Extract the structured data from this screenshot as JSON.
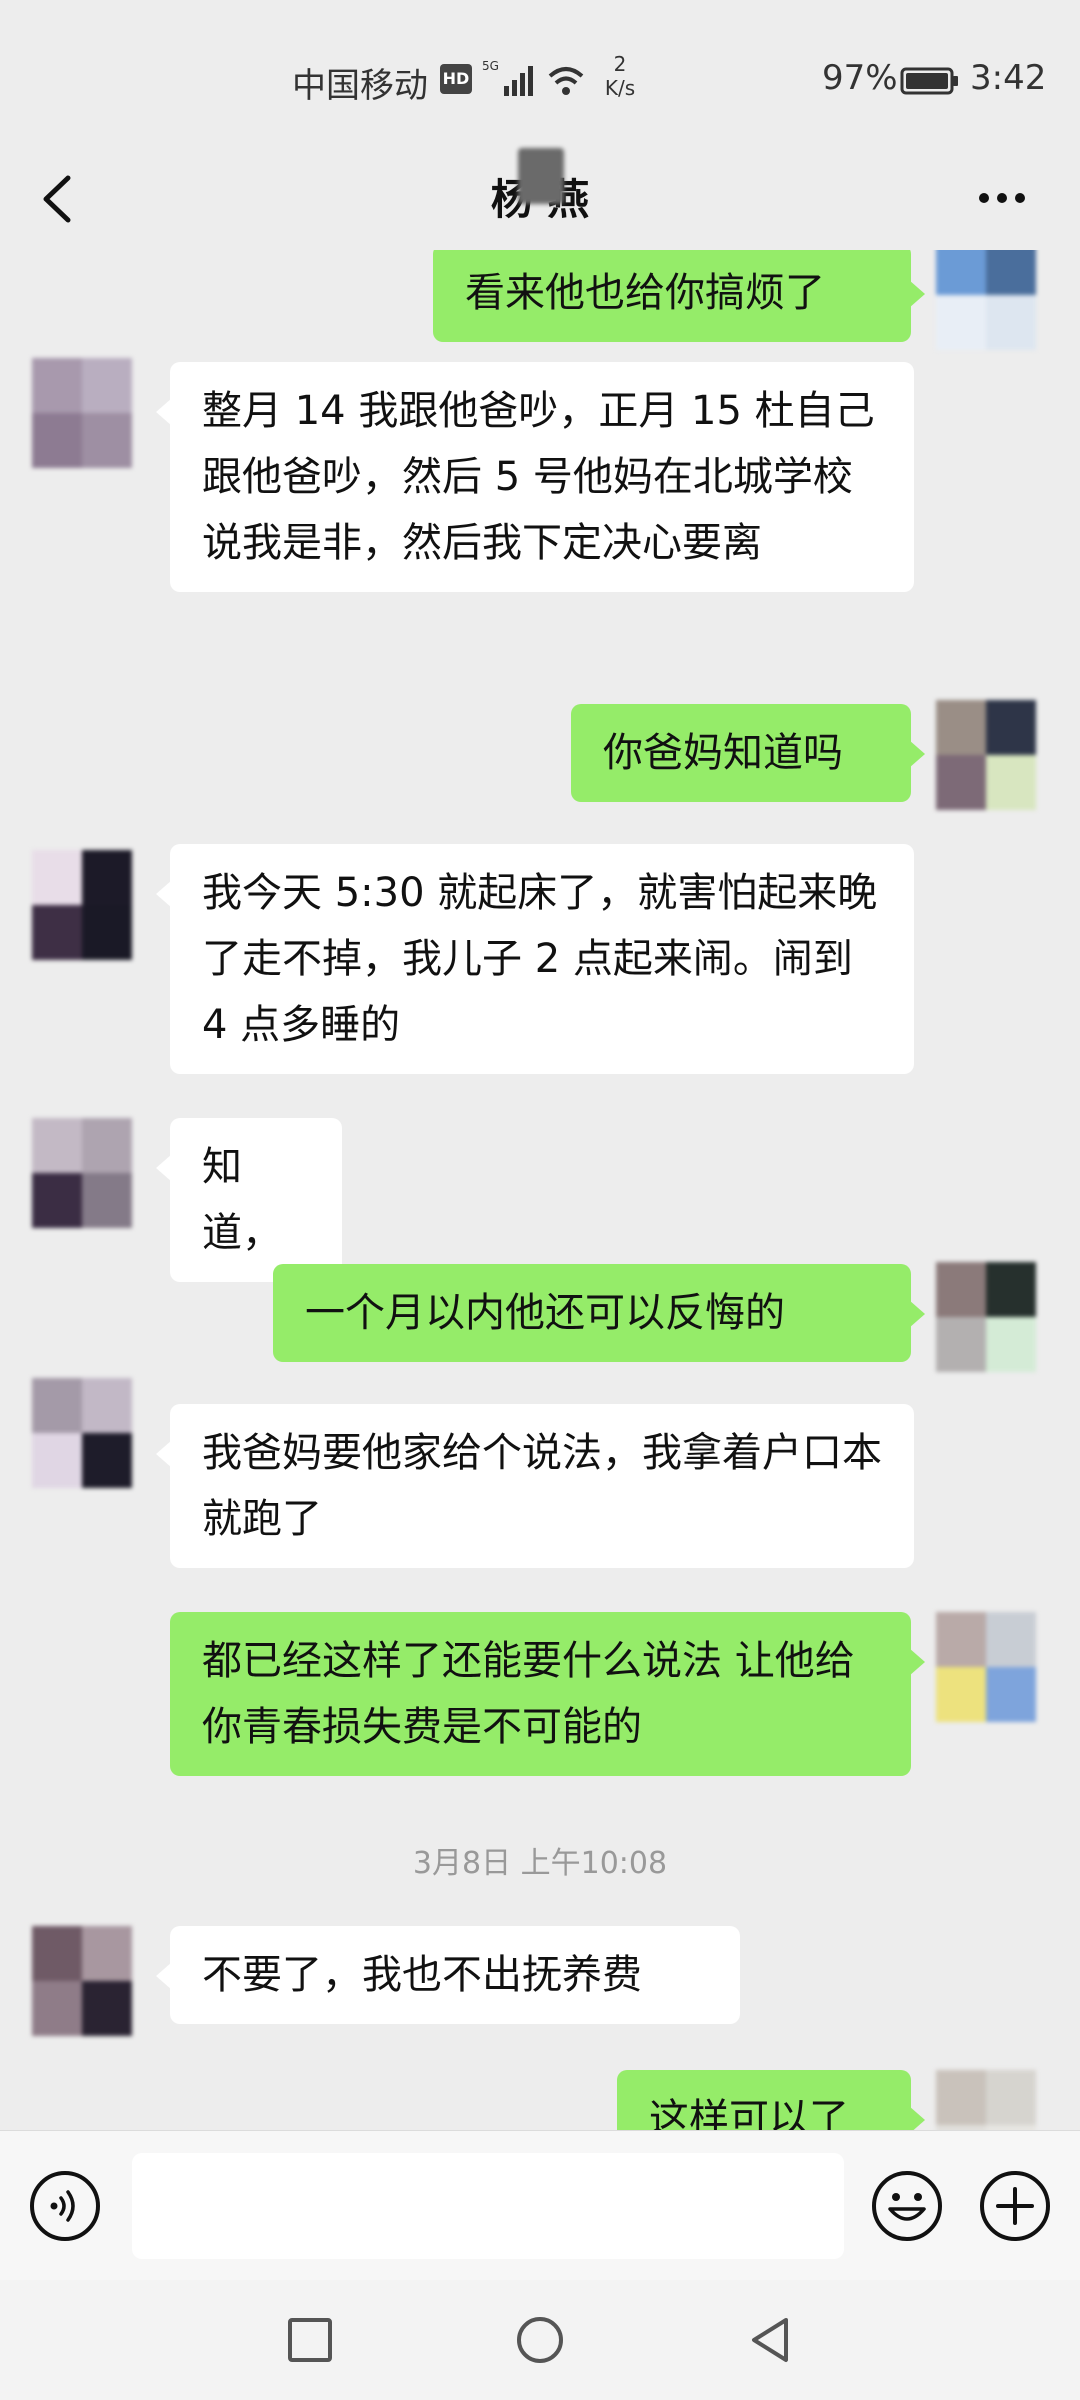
{
  "status_bar": {
    "carrier": "中国移动",
    "hd_badge": "HD",
    "network": "5G",
    "net_speed_value": "2",
    "net_speed_unit": "K/s",
    "battery_percent": "97%",
    "time": "3:42"
  },
  "nav": {
    "title": "杨  燕"
  },
  "messages": [
    {
      "side": "right",
      "text": "看来他也给你搞烦了"
    },
    {
      "side": "left",
      "text": "整月 14 我跟他爸吵，正月 15 杜自己跟他爸吵，然后 5 号他妈在北城学校说我是非，然后我下定决心要离"
    },
    {
      "side": "right",
      "text": "你爸妈知道吗"
    },
    {
      "side": "left",
      "text": "我今天 5:30 就起床了，就害怕起来晚了走不掉，我儿子 2 点起来闹。闹到 4 点多睡的"
    },
    {
      "side": "left",
      "text": "知道，"
    },
    {
      "side": "right",
      "text": "一个月以内他还可以反悔的"
    },
    {
      "side": "left",
      "text": "我爸妈要他家给个说法，我拿着户口本就跑了"
    },
    {
      "side": "right",
      "text": "都已经这样了还能要什么说法  让他给你青春损失费是不可能的"
    },
    {
      "side": "left",
      "text": "不要了，我也不出抚养费"
    },
    {
      "side": "right",
      "text": "这样可以了"
    }
  ],
  "timestamp": "3月8日 上午10:08",
  "colors": {
    "background": "#ededed",
    "sent_bubble": "#95ec69",
    "received_bubble": "#ffffff"
  },
  "icons": {
    "back": "chevron-left-icon",
    "more": "more-dots-icon",
    "voice": "voice-icon",
    "emoji": "emoji-icon",
    "plus": "plus-icon"
  }
}
